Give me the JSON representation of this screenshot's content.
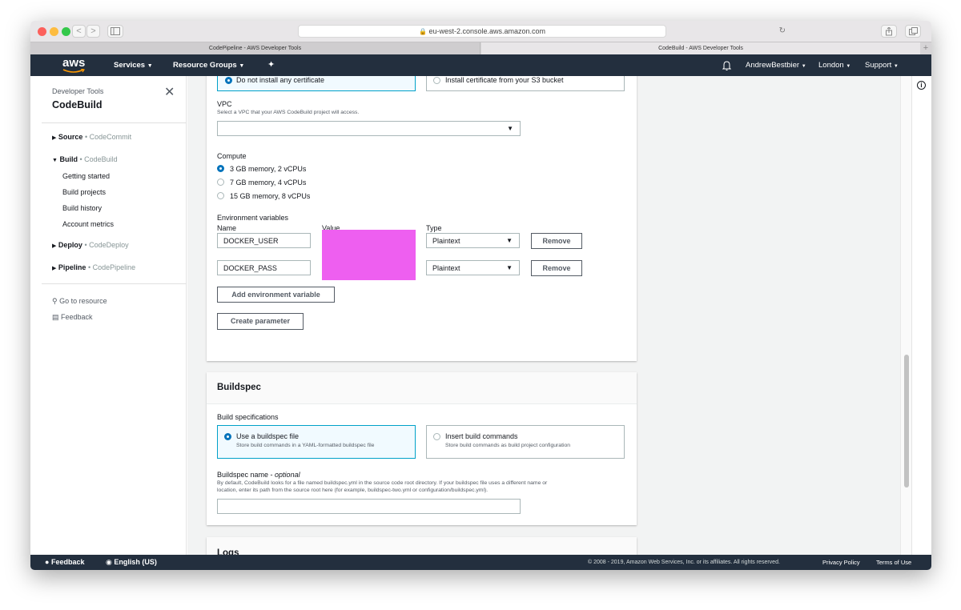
{
  "browser": {
    "url": "eu-west-2.console.aws.amazon.com",
    "tabs": [
      {
        "label": "CodePipeline - AWS Developer Tools"
      },
      {
        "label": "CodeBuild - AWS Developer Tools"
      }
    ],
    "back_glyph": "<",
    "forward_glyph": ">",
    "new_tab_glyph": "+"
  },
  "awsnav": {
    "logo": "aws",
    "services": "Services",
    "resource_groups": "Resource Groups",
    "user": "AndrewBestbier",
    "region": "London",
    "support": "Support"
  },
  "sidebar": {
    "section_label": "Developer Tools",
    "title": "CodeBuild",
    "groups": [
      {
        "label": "Source",
        "service": "• CodeCommit"
      },
      {
        "label": "Build",
        "service": "• CodeBuild"
      },
      {
        "label": "Deploy",
        "service": "• CodeDeploy"
      },
      {
        "label": "Pipeline",
        "service": "• CodePipeline"
      }
    ],
    "build_items": [
      "Getting started",
      "Build projects",
      "Build history",
      "Account metrics"
    ],
    "go_to_resource": "Go to resource",
    "feedback": "Feedback"
  },
  "env_panel": {
    "cert_option_1": "Do not install any certificate",
    "cert_option_2": "Install certificate from your S3 bucket",
    "vpc_label": "VPC",
    "vpc_help": "Select a VPC that your AWS CodeBuild project will access.",
    "vpc_value": "",
    "compute_label": "Compute",
    "compute_options": [
      "3 GB memory, 2 vCPUs",
      "7 GB memory, 4 vCPUs",
      "15 GB memory, 8 vCPUs"
    ],
    "compute_selected": 0,
    "env_vars_label": "Environment variables",
    "col_name": "Name",
    "col_value": "Value",
    "col_type": "Type",
    "rows": [
      {
        "name": "DOCKER_USER",
        "type": "Plaintext",
        "remove": "Remove"
      },
      {
        "name": "DOCKER_PASS",
        "type": "Plaintext",
        "remove": "Remove"
      }
    ],
    "redaction_color": "#ee5ff0",
    "add_env_var": "Add environment variable",
    "create_parameter": "Create parameter"
  },
  "buildspec_panel": {
    "title": "Buildspec",
    "specs_label": "Build specifications",
    "option_1_title": "Use a buildspec file",
    "option_1_desc": "Store build commands in a YAML-formatted buildspec file",
    "option_2_title": "Insert build commands",
    "option_2_desc": "Store build commands as build project configuration",
    "name_label": "Buildspec name - ",
    "name_optional": "optional",
    "name_help_1": "By default, CodeBuild looks for a file named buildspec.yml in the source code root directory. If your buildspec file uses a different name or",
    "name_help_2": "location, enter its path from the source root here (for example, buildspec-two.yml or configuration/buildspec.yml).",
    "name_value": ""
  },
  "logs_panel": {
    "title": "Logs"
  },
  "footer": {
    "feedback": "Feedback",
    "language": "English (US)",
    "copyright": "© 2008 - 2019, Amazon Web Services, Inc. or its affiliates. All rights reserved.",
    "privacy": "Privacy Policy",
    "terms": "Terms of Use"
  },
  "colors": {
    "nav_bg": "#232f3e",
    "accent": "#0073bb",
    "selected_tile_border": "#00a1c9",
    "content_bg": "#f2f3f3"
  }
}
